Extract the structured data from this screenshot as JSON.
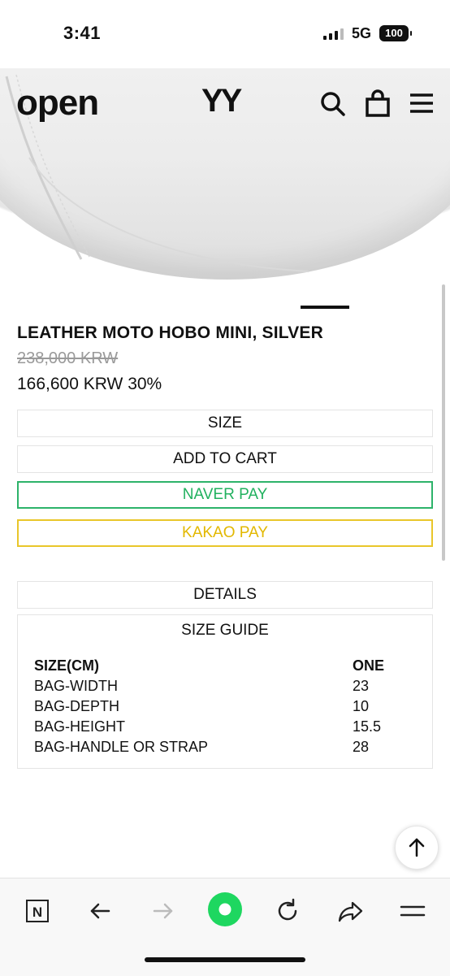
{
  "status_bar": {
    "time": "3:41",
    "network": "5G",
    "battery": "100"
  },
  "header": {
    "logo": "open",
    "monogram": "YY"
  },
  "product": {
    "title": "LEATHER MOTO HOBO MINI, SILVER",
    "original_price": "238,000 KRW",
    "sale_price": "166,600 KRW 30%"
  },
  "buttons": {
    "size": "SIZE",
    "add_to_cart": "ADD TO CART",
    "naver_pay": "NAVER PAY",
    "kakao_pay": "KAKAO PAY",
    "details": "DETAILS"
  },
  "size_guide": {
    "title": "SIZE GUIDE",
    "header": {
      "label": "SIZE(CM)",
      "value": "ONE"
    },
    "rows": [
      {
        "label": "BAG-WIDTH",
        "value": "23"
      },
      {
        "label": "BAG-DEPTH",
        "value": "10"
      },
      {
        "label": "BAG-HEIGHT",
        "value": "15.5"
      },
      {
        "label": "BAG-HANDLE OR STRAP",
        "value": "28"
      }
    ]
  },
  "colors": {
    "naver": "#22b15f",
    "kakao": "#e2b800",
    "browser_accent": "#1ed760"
  },
  "icons": [
    "search-icon",
    "bag-icon",
    "menu-icon",
    "arrow-up-icon",
    "tabs-icon",
    "back-icon",
    "forward-icon",
    "home-icon",
    "reload-icon",
    "share-icon"
  ]
}
